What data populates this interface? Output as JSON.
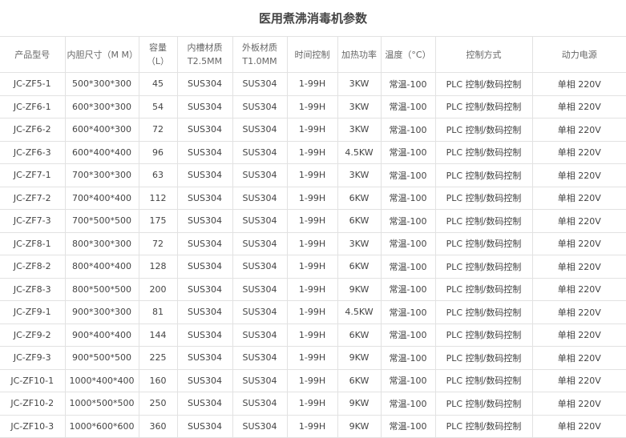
{
  "title": "医用煮沸消毒机参数",
  "headers": [
    "产品型号",
    "内胆尺寸（M M）",
    "容量（L）",
    "内槽材质 T2.5MM",
    "外板材质 T1.0MM",
    "时间控制",
    "加热功率",
    "温度（°C）",
    "控制方式",
    "动力电源"
  ],
  "rows": [
    [
      "JC-ZF5-1",
      "500*300*300",
      "45",
      "SUS304",
      "SUS304",
      "1-99H",
      "3KW",
      "常温-100",
      "PLC 控制/数码控制",
      "单相 220V"
    ],
    [
      "JC-ZF6-1",
      "600*300*300",
      "54",
      "SUS304",
      "SUS304",
      "1-99H",
      "3KW",
      "常温-100",
      "PLC 控制/数码控制",
      "单相 220V"
    ],
    [
      "JC-ZF6-2",
      "600*400*300",
      "72",
      "SUS304",
      "SUS304",
      "1-99H",
      "3KW",
      "常温-100",
      "PLC 控制/数码控制",
      "单相 220V"
    ],
    [
      "JC-ZF6-3",
      "600*400*400",
      "96",
      "SUS304",
      "SUS304",
      "1-99H",
      "4.5KW",
      "常温-100",
      "PLC 控制/数码控制",
      "单相 220V"
    ],
    [
      "JC-ZF7-1",
      "700*300*300",
      "63",
      "SUS304",
      "SUS304",
      "1-99H",
      "3KW",
      "常温-100",
      "PLC 控制/数码控制",
      "单相 220V"
    ],
    [
      "JC-ZF7-2",
      "700*400*400",
      "112",
      "SUS304",
      "SUS304",
      "1-99H",
      "6KW",
      "常温-100",
      "PLC 控制/数码控制",
      "单相 220V"
    ],
    [
      "JC-ZF7-3",
      "700*500*500",
      "175",
      "SUS304",
      "SUS304",
      "1-99H",
      "6KW",
      "常温-100",
      "PLC 控制/数码控制",
      "单相 220V"
    ],
    [
      "JC-ZF8-1",
      "800*300*300",
      "72",
      "SUS304",
      "SUS304",
      "1-99H",
      "3KW",
      "常温-100",
      "PLC 控制/数码控制",
      "单相 220V"
    ],
    [
      "JC-ZF8-2",
      "800*400*400",
      "128",
      "SUS304",
      "SUS304",
      "1-99H",
      "6KW",
      "常温-100",
      "PLC 控制/数码控制",
      "单相 220V"
    ],
    [
      "JC-ZF8-3",
      "800*500*500",
      "200",
      "SUS304",
      "SUS304",
      "1-99H",
      "9KW",
      "常温-100",
      "PLC 控制/数码控制",
      "单相 220V"
    ],
    [
      "JC-ZF9-1",
      "900*300*300",
      "81",
      "SUS304",
      "SUS304",
      "1-99H",
      "4.5KW",
      "常温-100",
      "PLC 控制/数码控制",
      "单相 220V"
    ],
    [
      "JC-ZF9-2",
      "900*400*400",
      "144",
      "SUS304",
      "SUS304",
      "1-99H",
      "6KW",
      "常温-100",
      "PLC 控制/数码控制",
      "单相 220V"
    ],
    [
      "JC-ZF9-3",
      "900*500*500",
      "225",
      "SUS304",
      "SUS304",
      "1-99H",
      "9KW",
      "常温-100",
      "PLC 控制/数码控制",
      "单相 220V"
    ],
    [
      "JC-ZF10-1",
      "1000*400*400",
      "160",
      "SUS304",
      "SUS304",
      "1-99H",
      "6KW",
      "常温-100",
      "PLC 控制/数码控制",
      "单相 220V"
    ],
    [
      "JC-ZF10-2",
      "1000*500*500",
      "250",
      "SUS304",
      "SUS304",
      "1-99H",
      "9KW",
      "常温-100",
      "PLC 控制/数码控制",
      "单相 220V"
    ],
    [
      "JC-ZF10-3",
      "1000*600*600",
      "360",
      "SUS304",
      "SUS304",
      "1-99H",
      "9KW",
      "常温-100",
      "PLC 控制/数码控制",
      "单相 220V"
    ]
  ]
}
